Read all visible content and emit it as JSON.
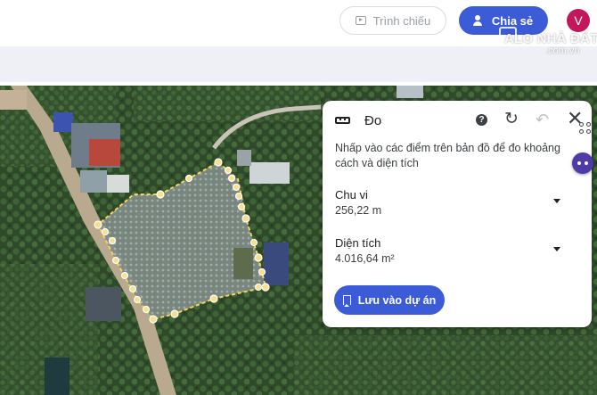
{
  "header": {
    "present_label": "Trình chiếu",
    "share_label": "Chia sẻ",
    "avatar_letter": "V"
  },
  "watermark": {
    "text": "ALO NHÀ ĐẤT",
    "sub": ".com.vn"
  },
  "measure_panel": {
    "title": "Đo",
    "description": "Nhấp vào các điểm trên bản đồ để đo khoảng cách và diện tích",
    "perimeter_label": "Chu vi",
    "perimeter_value": "256,22 m",
    "area_label": "Diện tích",
    "area_value": "4.016,64 m²",
    "save_label": "Lưu vào dự án",
    "help_glyph": "?",
    "refresh_glyph": "↻",
    "undo_glyph": "↶",
    "close_glyph": "✕"
  },
  "colors": {
    "accent": "#3c5bd6",
    "measure_line": "#f7d35a",
    "avatar": "#c2185b"
  }
}
